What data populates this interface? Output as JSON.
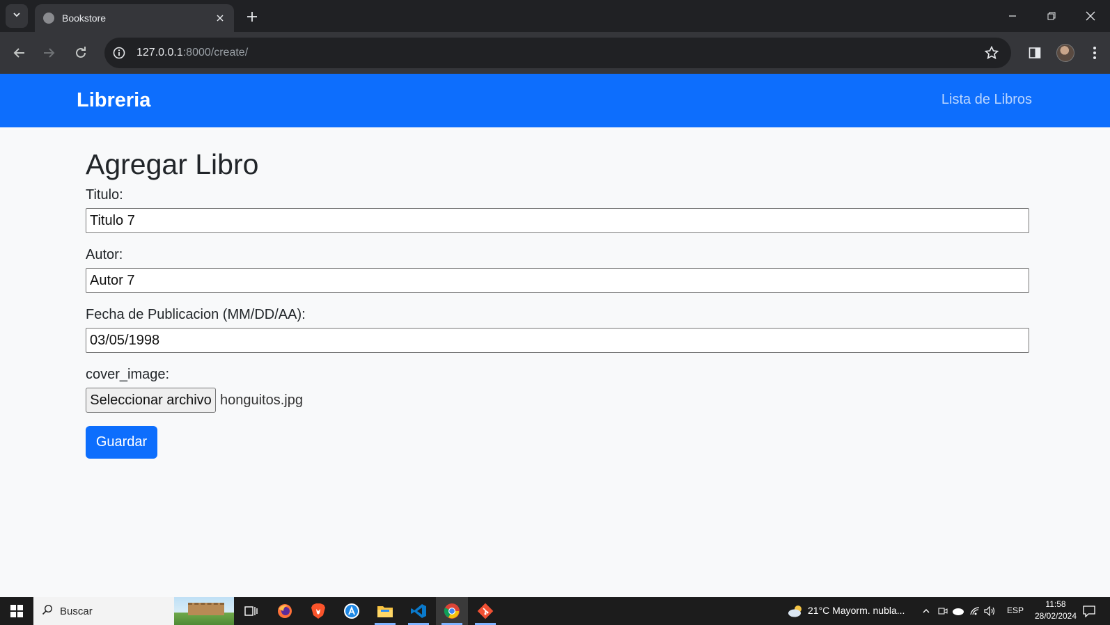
{
  "browser": {
    "tab_title": "Bookstore",
    "url_host": "127.0.0.1",
    "url_rest": ":8000/create/"
  },
  "navbar": {
    "brand": "Libreria",
    "link": "Lista de Libros",
    "color": "#0d6efd"
  },
  "form": {
    "title": "Agregar Libro",
    "fields": [
      {
        "label": "Titulo:",
        "value": "Titulo 7"
      },
      {
        "label": "Autor:",
        "value": "Autor 7"
      },
      {
        "label": "Fecha de Publicacion (MM/DD/AA):",
        "value": "03/05/1998"
      }
    ],
    "file": {
      "label": "cover_image:",
      "button": "Seleccionar archivo",
      "filename": "honguitos.jpg"
    },
    "submit": "Guardar"
  },
  "taskbar": {
    "search_placeholder": "Buscar",
    "weather": "21°C  Mayorm. nubla...",
    "language": "ESP",
    "time": "11:58",
    "date": "28/02/2024",
    "apps": [
      "task-view",
      "firefox",
      "brave",
      "app-store",
      "file-explorer",
      "vscode",
      "chrome",
      "git"
    ]
  }
}
